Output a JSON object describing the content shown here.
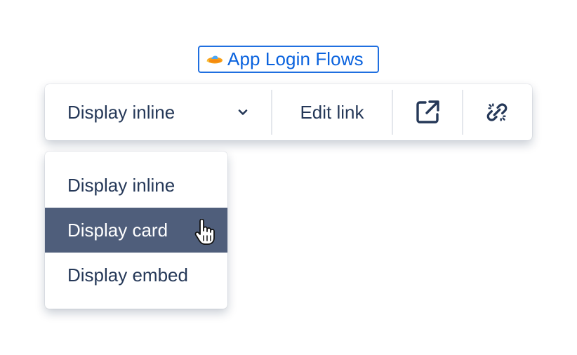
{
  "link": {
    "title": "App Login Flows",
    "icon": "spaceship-icon"
  },
  "toolbar": {
    "appearance_selected": "Display inline",
    "edit_label": "Edit link",
    "open_icon": "open-in-new-window-icon",
    "unlink_icon": "unlink-icon"
  },
  "dropdown": {
    "items": [
      {
        "label": "Display inline",
        "selected": false
      },
      {
        "label": "Display card",
        "selected": true
      },
      {
        "label": "Display embed",
        "selected": false
      }
    ]
  },
  "colors": {
    "link": "#0b63de",
    "link_border": "#1f6fe0",
    "text": "#253858",
    "selected_bg": "#4f5e7b",
    "selected_text": "#ffffff"
  }
}
